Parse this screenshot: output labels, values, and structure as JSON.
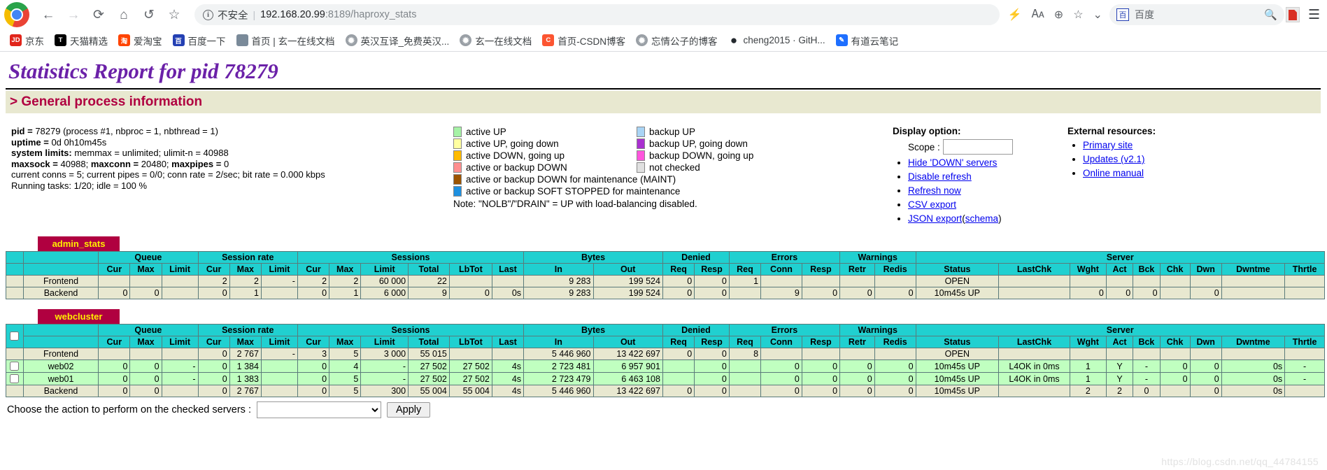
{
  "browser": {
    "nav": {
      "back": "←",
      "forward": "→",
      "reload": "⟳",
      "home": "⌂",
      "history": "↺",
      "bookmark": "☆"
    },
    "omnibox": {
      "info_icon": "i",
      "security_text": "不安全",
      "separator": "|",
      "url_host": "192.168.20.99",
      "url_rest": ":8189/haproxy_stats"
    },
    "toolbar_icons": [
      "flash-icon",
      "translate-icon",
      "zoom-icon",
      "star-icon",
      "chevron-down-icon"
    ],
    "search": {
      "engine_label": "百度",
      "engine_icon": "百",
      "magnifier": "search-icon"
    },
    "pdf_icon": "pdf-icon",
    "menu_icon": "⋮",
    "bookmarks": [
      {
        "label": "京东",
        "icon_text": "JD",
        "color": "#e1251b"
      },
      {
        "label": "天猫精选",
        "icon_text": "T",
        "color": "#000000"
      },
      {
        "label": "爱淘宝",
        "icon_text": "淘",
        "color": "#ff4400"
      },
      {
        "label": "百度一下",
        "icon_text": "百",
        "color": "#2440b3"
      },
      {
        "label": "首页 | 玄一在线文档",
        "icon_text": "",
        "color": "#7a8a99"
      },
      {
        "label": "英汉互译_免费英汉...",
        "icon_text": "🌐",
        "color": "#9aa0a6"
      },
      {
        "label": "玄一在线文档",
        "icon_text": "🌐",
        "color": "#9aa0a6"
      },
      {
        "label": "首页-CSDN博客",
        "icon_text": "C",
        "color": "#fc5531"
      },
      {
        "label": "忘情公子的博客",
        "icon_text": "🌐",
        "color": "#9aa0a6"
      },
      {
        "label": "cheng2015 · GitH...",
        "icon_text": "●",
        "color": "#24292e"
      },
      {
        "label": "有道云笔记",
        "icon_text": "✎",
        "color": "#1e6fff"
      }
    ]
  },
  "page": {
    "title": "Statistics Report for pid 78279",
    "section_heading": "> General process information",
    "process_info": {
      "pid_label": "pid =",
      "pid_value": "78279 (process #1, nbproc = 1, nbthread = 1)",
      "uptime_label": "uptime =",
      "uptime_value": "0d 0h10m45s",
      "limits_label": "system limits:",
      "limits_value": "memmax = unlimited; ulimit-n = 40988",
      "maxsock_label": "maxsock =",
      "maxsock_value": "40988;",
      "maxconn_label": "maxconn =",
      "maxconn_value": "20480;",
      "maxpipes_label": "maxpipes =",
      "maxpipes_value": "0",
      "current": "current conns = 5; current pipes = 0/0; conn rate = 2/sec; bit rate = 0.000 kbps",
      "tasks": "Running tasks: 1/20; idle = 100 %"
    },
    "legend": {
      "left": [
        {
          "label": "active UP",
          "color": "#a6f2a6"
        },
        {
          "label": "active UP, going down",
          "color": "#ffffa0"
        },
        {
          "label": "active DOWN, going up",
          "color": "#ffbb00"
        },
        {
          "label": "active or backup DOWN",
          "color": "#ff8f8f"
        },
        {
          "label": "active or backup DOWN for maintenance (MAINT)",
          "color": "#9c5400"
        },
        {
          "label": "active or backup SOFT STOPPED for maintenance",
          "color": "#1e90e0"
        }
      ],
      "right": [
        {
          "label": "backup UP",
          "color": "#a9d4f5"
        },
        {
          "label": "backup UP, going down",
          "color": "#a930d0"
        },
        {
          "label": "backup DOWN, going up",
          "color": "#ff55dd"
        },
        {
          "label": "not checked",
          "color": "#e0e0e0"
        }
      ],
      "note": "Note: \"NOLB\"/\"DRAIN\" = UP with load-balancing disabled."
    },
    "display_option": {
      "title": "Display option:",
      "scope_label": "Scope :",
      "scope_value": "",
      "links": [
        "Hide 'DOWN' servers",
        "Disable refresh",
        "Refresh now",
        "CSV export"
      ],
      "json_export": "JSON export",
      "json_schema_open": "(",
      "json_schema": "schema",
      "json_schema_close": ")"
    },
    "external_resources": {
      "title": "External resources:",
      "links": [
        "Primary site",
        "Updates (v2.1)",
        "Online manual"
      ]
    },
    "group_headers": [
      "Queue",
      "Session rate",
      "Sessions",
      "Bytes",
      "Denied",
      "Errors",
      "Warnings",
      "Server"
    ],
    "sub_headers": [
      "Cur",
      "Max",
      "Limit",
      "Cur",
      "Max",
      "Limit",
      "Cur",
      "Max",
      "Limit",
      "Total",
      "LbTot",
      "Last",
      "In",
      "Out",
      "Req",
      "Resp",
      "Req",
      "Conn",
      "Resp",
      "Retr",
      "Redis",
      "Status",
      "LastChk",
      "Wght",
      "Act",
      "Bck",
      "Chk",
      "Dwn",
      "Dwntme",
      "Thrtle"
    ],
    "proxies": [
      {
        "name": "admin_stats",
        "has_checkboxes": false,
        "rows": [
          {
            "kind": "frontend",
            "name": "Frontend",
            "checkbox": false,
            "q_cur": "",
            "q_max": "",
            "q_limit": "",
            "sr_cur": "2",
            "sr_max": "2",
            "sr_limit": "-",
            "s_cur": "2",
            "s_max": "2",
            "s_limit": "60 000",
            "s_total": "22",
            "s_lbtot": "",
            "s_last": "",
            "b_in": "9 283",
            "b_out": "199 524",
            "d_req": "0",
            "d_resp": "0",
            "e_req": "1",
            "e_conn": "",
            "e_resp": "",
            "w_retr": "",
            "w_redis": "",
            "status": "OPEN",
            "lastchk": "",
            "wght": "",
            "act": "",
            "bck": "",
            "chk": "",
            "dwn": "",
            "dwntme": "",
            "thrtle": ""
          },
          {
            "kind": "backend",
            "name": "Backend",
            "checkbox": false,
            "q_cur": "0",
            "q_max": "0",
            "q_limit": "",
            "sr_cur": "0",
            "sr_max": "1",
            "sr_limit": "",
            "s_cur": "0",
            "s_max": "1",
            "s_limit": "6 000",
            "s_total": "9",
            "s_lbtot": "0",
            "s_last": "0s",
            "b_in": "9 283",
            "b_out": "199 524",
            "d_req": "0",
            "d_resp": "0",
            "e_req": "",
            "e_conn": "9",
            "e_resp": "0",
            "w_retr": "0",
            "w_redis": "0",
            "status": "10m45s UP",
            "lastchk": "",
            "wght": "0",
            "act": "0",
            "bck": "0",
            "chk": "",
            "dwn": "0",
            "dwntme": "",
            "thrtle": ""
          }
        ]
      },
      {
        "name": "webcluster",
        "has_checkboxes": true,
        "rows": [
          {
            "kind": "frontend",
            "name": "Frontend",
            "checkbox": false,
            "q_cur": "",
            "q_max": "",
            "q_limit": "",
            "sr_cur": "0",
            "sr_max": "2 767",
            "sr_limit": "-",
            "s_cur": "3",
            "s_max": "5",
            "s_limit": "3 000",
            "s_total": "55 015",
            "s_lbtot": "",
            "s_last": "",
            "b_in": "5 446 960",
            "b_out": "13 422 697",
            "d_req": "0",
            "d_resp": "0",
            "e_req": "8",
            "e_conn": "",
            "e_resp": "",
            "w_retr": "",
            "w_redis": "",
            "status": "OPEN",
            "lastchk": "",
            "wght": "",
            "act": "",
            "bck": "",
            "chk": "",
            "dwn": "",
            "dwntme": "",
            "thrtle": ""
          },
          {
            "kind": "server",
            "name": "web02",
            "checkbox": true,
            "q_cur": "0",
            "q_max": "0",
            "q_limit": "-",
            "sr_cur": "0",
            "sr_max": "1 384",
            "sr_limit": "",
            "s_cur": "0",
            "s_max": "4",
            "s_limit": "-",
            "s_total": "27 502",
            "s_lbtot": "27 502",
            "s_last": "4s",
            "b_in": "2 723 481",
            "b_out": "6 957 901",
            "d_req": "",
            "d_resp": "0",
            "e_req": "",
            "e_conn": "0",
            "e_resp": "0",
            "w_retr": "0",
            "w_redis": "0",
            "status": "10m45s UP",
            "lastchk": "L4OK in 0ms",
            "wght": "1",
            "act": "Y",
            "bck": "-",
            "chk": "0",
            "dwn": "0",
            "dwntme": "0s",
            "thrtle": "-"
          },
          {
            "kind": "server",
            "name": "web01",
            "checkbox": true,
            "q_cur": "0",
            "q_max": "0",
            "q_limit": "-",
            "sr_cur": "0",
            "sr_max": "1 383",
            "sr_limit": "",
            "s_cur": "0",
            "s_max": "5",
            "s_limit": "-",
            "s_total": "27 502",
            "s_lbtot": "27 502",
            "s_last": "4s",
            "b_in": "2 723 479",
            "b_out": "6 463 108",
            "d_req": "",
            "d_resp": "0",
            "e_req": "",
            "e_conn": "0",
            "e_resp": "0",
            "w_retr": "0",
            "w_redis": "0",
            "status": "10m45s UP",
            "lastchk": "L4OK in 0ms",
            "wght": "1",
            "act": "Y",
            "bck": "-",
            "chk": "0",
            "dwn": "0",
            "dwntme": "0s",
            "thrtle": "-"
          },
          {
            "kind": "backend",
            "name": "Backend",
            "checkbox": false,
            "q_cur": "0",
            "q_max": "0",
            "q_limit": "",
            "sr_cur": "0",
            "sr_max": "2 767",
            "sr_limit": "",
            "s_cur": "0",
            "s_max": "5",
            "s_limit": "300",
            "s_total": "55 004",
            "s_lbtot": "55 004",
            "s_last": "4s",
            "b_in": "5 446 960",
            "b_out": "13 422 697",
            "d_req": "0",
            "d_resp": "0",
            "e_req": "",
            "e_conn": "0",
            "e_resp": "0",
            "w_retr": "0",
            "w_redis": "0",
            "status": "10m45s UP",
            "lastchk": "",
            "wght": "2",
            "act": "2",
            "bck": "0",
            "chk": "",
            "dwn": "0",
            "dwntme": "0s",
            "thrtle": ""
          }
        ]
      }
    ],
    "action_bar": {
      "label": "Choose the action to perform on the checked servers :",
      "selected": "",
      "apply_label": "Apply"
    },
    "watermark": "https://blog.csdn.net/qq_44784155"
  }
}
